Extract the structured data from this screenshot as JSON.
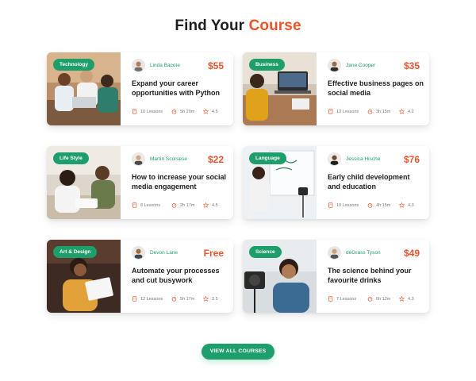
{
  "header": {
    "title_prefix": "Find Your",
    "title_accent": "Course"
  },
  "courses": [
    {
      "category": "Technology",
      "author": "Linda Bacote",
      "price": "$55",
      "title": "Expand your career opportunities with Python",
      "lessons": "10 Lessons",
      "duration": "5h 20m",
      "rating": "4.5"
    },
    {
      "category": "Business",
      "author": "Jane Cooper",
      "price": "$35",
      "title": "Effective business pages on social media",
      "lessons": "13 Lessons",
      "duration": "3h 15m",
      "rating": "4.2"
    },
    {
      "category": "Life Style",
      "author": "Martin Scorsese",
      "price": "$22",
      "title": "How to increase your social media engagement",
      "lessons": "8 Lessons",
      "duration": "2h 17m",
      "rating": "4.5"
    },
    {
      "category": "Language",
      "author": "Jessica Hische",
      "price": "$76",
      "title": "Early child development and education",
      "lessons": "10 Lessons",
      "duration": "4h 15m",
      "rating": "4.3"
    },
    {
      "category": "Art & Design",
      "author": "Devon Lane",
      "price": "Free",
      "title": "Automate your processes and cut busywork",
      "lessons": "12 Lessons",
      "duration": "5h 17m",
      "rating": "3.5"
    },
    {
      "category": "Science",
      "author": "deGrass Tyson",
      "price": "$49",
      "title": "The science behind your favourite drinks",
      "lessons": "7 Lessons",
      "duration": "6h 12m",
      "rating": "4.3"
    }
  ],
  "icons": {
    "lessons": "book-icon",
    "duration": "alarm-clock-icon",
    "rating": "star-icon"
  },
  "colors": {
    "accent": "#e8542b",
    "brand_green": "#1e9e6a"
  },
  "cta": {
    "label": "VIEW ALL COURSES"
  }
}
